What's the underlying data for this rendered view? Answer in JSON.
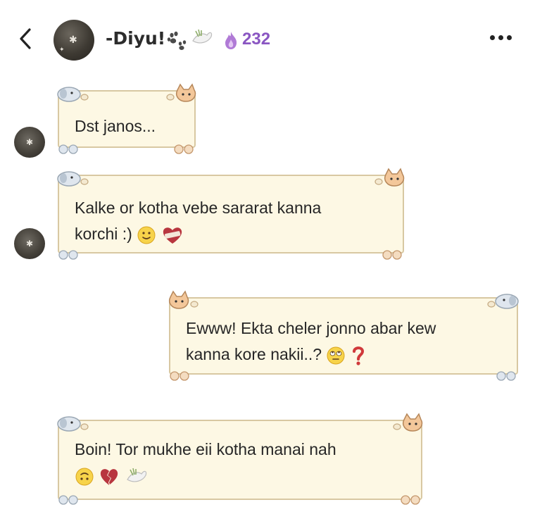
{
  "header": {
    "name": "-Diyu!",
    "reputation": "232"
  },
  "messages": [
    {
      "side": "left",
      "lines": [
        "Dst janos..."
      ]
    },
    {
      "side": "left",
      "lines": [
        "Kalke or kotha vebe sararat kanna",
        "korchi :)"
      ]
    },
    {
      "side": "right",
      "lines": [
        "Ewww! Ekta cheler jonno abar kew",
        "kanna kore nakii..?"
      ]
    },
    {
      "side": "left",
      "lines": [
        "Boin! Tor mukhe eii kotha manai nah"
      ]
    }
  ],
  "colors": {
    "bubble_fill": "#fdf8e4",
    "bubble_border": "#d8c8a2",
    "reputation_purple": "#8a56c2",
    "question_red": "#d0393b"
  },
  "icons": [
    "back-chevron-icon",
    "paw-icon",
    "dove-icon",
    "flame-icon",
    "more-dots-icon",
    "puppy-sticker-icon",
    "kitten-sticker-icon",
    "paw-print-icon",
    "slight-smile-emoji-icon",
    "heart-bandage-emoji-icon",
    "eye-roll-emoji-icon",
    "question-mark-icon",
    "upside-down-emoji-icon",
    "broken-heart-emoji-icon"
  ]
}
